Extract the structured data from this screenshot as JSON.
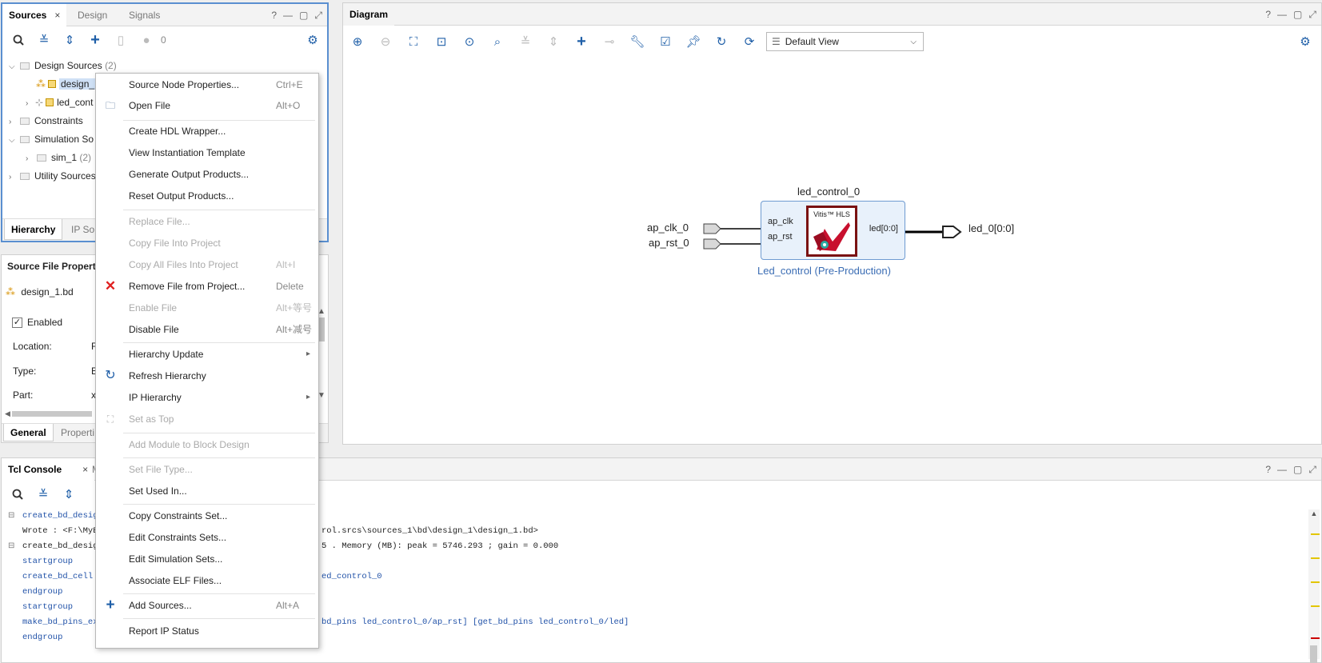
{
  "sources_panel": {
    "tabs": [
      "Sources",
      "Design",
      "Signals"
    ],
    "close": "×",
    "count": "0",
    "tree": {
      "design_sources": "Design Sources",
      "design_sources_count": "(2)",
      "item1": "design_",
      "item2": "led_cont",
      "constraints": "Constraints",
      "simulation_sources": "Simulation So",
      "sim1": "sim_1",
      "sim1_count": "(2)",
      "utility_sources": "Utility Sources"
    },
    "bottom_tabs": [
      "Hierarchy",
      "IP So"
    ]
  },
  "properties_panel": {
    "title": "Source File Properti",
    "file": "design_1.bd",
    "enabled_label": "Enabled",
    "location_label": "Location:",
    "location_value": "F",
    "type_label": "Type:",
    "type_value": "E",
    "part_label": "Part:",
    "part_value": "x",
    "bottom_tabs": [
      "General",
      "Properti"
    ]
  },
  "diagram": {
    "title": "Diagram",
    "view_select": "Default View",
    "block": {
      "instance": "led_control_0",
      "subtitle": "Led_control (Pre-Production)",
      "logo_text": "Vitis™ HLS",
      "in_pins": [
        "ap_clk",
        "ap_rst"
      ],
      "out_pin": "led[0:0]"
    },
    "ports_in": [
      "ap_clk_0",
      "ap_rst_0"
    ],
    "port_out": "led_0[0:0]"
  },
  "console": {
    "title": "Tcl Console",
    "close": "×",
    "truncated_tab": "M",
    "lines": [
      {
        "text": "create_bd_design",
        "cls": "blue",
        "fold": true
      },
      {
        "text": "Wrote  : <F:\\MyE",
        "cls": "",
        "tail": "rol.srcs\\sources_1\\bd\\design_1\\design_1.bd>"
      },
      {
        "text": "create_bd_design",
        "cls": "",
        "fold": true,
        "tail": "5 . Memory (MB): peak = 5746.293 ; gain = 0.000"
      },
      {
        "text": "startgroup",
        "cls": "blue"
      },
      {
        "text": "create_bd_cell -",
        "cls": "blue",
        "tail": "ed_control_0"
      },
      {
        "text": "endgroup",
        "cls": "blue"
      },
      {
        "text": "startgroup",
        "cls": "blue"
      },
      {
        "text": "make_bd_pins_ext",
        "cls": "blue",
        "tail": "bd_pins led_control_0/ap_rst] [get_bd_pins led_control_0/led]"
      },
      {
        "text": "endgroup",
        "cls": "blue"
      }
    ]
  },
  "context_menu": {
    "items": [
      {
        "label": "Source Node Properties...",
        "shortcut": "Ctrl+E"
      },
      {
        "label": "Open File",
        "shortcut": "Alt+O"
      },
      {
        "label": "Create HDL Wrapper..."
      },
      {
        "label": "View Instantiation Template"
      },
      {
        "label": "Generate Output Products..."
      },
      {
        "label": "Reset Output Products..."
      },
      {
        "label": "Replace File..."
      },
      {
        "label": "Copy File Into Project"
      },
      {
        "label": "Copy All Files Into Project",
        "shortcut": "Alt+I"
      },
      {
        "label": "Remove File from Project...",
        "shortcut": "Delete"
      },
      {
        "label": "Enable File",
        "shortcut": "Alt+等号"
      },
      {
        "label": "Disable File",
        "shortcut": "Alt+减号"
      },
      {
        "label": "Hierarchy Update"
      },
      {
        "label": "Refresh Hierarchy"
      },
      {
        "label": "IP Hierarchy"
      },
      {
        "label": "Set as Top"
      },
      {
        "label": "Add Module to Block Design"
      },
      {
        "label": "Set File Type..."
      },
      {
        "label": "Set Used In..."
      },
      {
        "label": "Copy Constraints Set..."
      },
      {
        "label": "Edit Constraints Sets..."
      },
      {
        "label": "Edit Simulation Sets..."
      },
      {
        "label": "Associate ELF Files..."
      },
      {
        "label": "Add Sources...",
        "shortcut": "Alt+A"
      },
      {
        "label": "Report IP Status"
      }
    ]
  },
  "colors": {
    "accent": "#1f5fa8",
    "block_fill": "#e8f1fb",
    "block_border": "#6f9bd1",
    "remove_icon": "#e02020"
  }
}
